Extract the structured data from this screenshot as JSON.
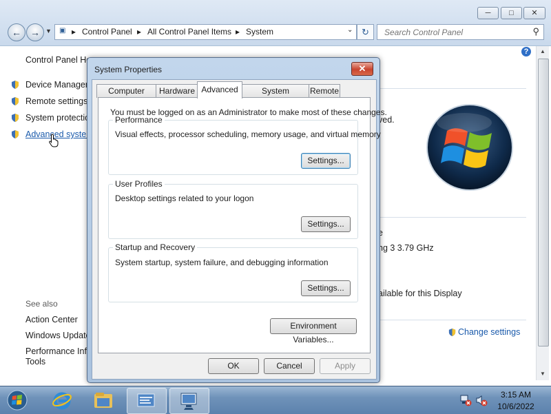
{
  "explorer": {
    "breadcrumb": [
      "Control Panel",
      "All Control Panel Items",
      "System"
    ],
    "search_placeholder": "Search Control Panel",
    "left_pane": {
      "home_label": "Control Panel Ho",
      "tasks": [
        "Device Manager",
        "Remote settings",
        "System protectio",
        "Advanced system"
      ],
      "see_also_label": "See also",
      "see_also": [
        "Action Center",
        "Windows Update",
        "Performance Info",
        "Tools"
      ]
    },
    "right_pane": {
      "fragments": [
        "ved.",
        "e",
        "ng 3   3.79 GHz",
        "ailable for this Display"
      ],
      "change_settings": "Change settings"
    }
  },
  "dialog": {
    "title": "System Properties",
    "close_glyph": "✕",
    "tabs": [
      "Computer Name",
      "Hardware",
      "Advanced",
      "System Protection",
      "Remote"
    ],
    "active_tab": "Advanced",
    "admin_note": "You must be logged on as an Administrator to make most of these changes.",
    "groups": [
      {
        "title": "Performance",
        "desc": "Visual effects, processor scheduling, memory usage, and virtual memory",
        "button": "Settings..."
      },
      {
        "title": "User Profiles",
        "desc": "Desktop settings related to your logon",
        "button": "Settings..."
      },
      {
        "title": "Startup and Recovery",
        "desc": "System startup, system failure, and debugging information",
        "button": "Settings..."
      }
    ],
    "env_button": "Environment Variables...",
    "ok": "OK",
    "cancel": "Cancel",
    "apply": "Apply"
  },
  "taskbar": {
    "time": "3:15 AM",
    "date": "10/6/2022"
  },
  "colors": {
    "accent": "#1a5aab",
    "taskbar": "#6f92b9",
    "dialog_frame": "#a9c2de"
  }
}
